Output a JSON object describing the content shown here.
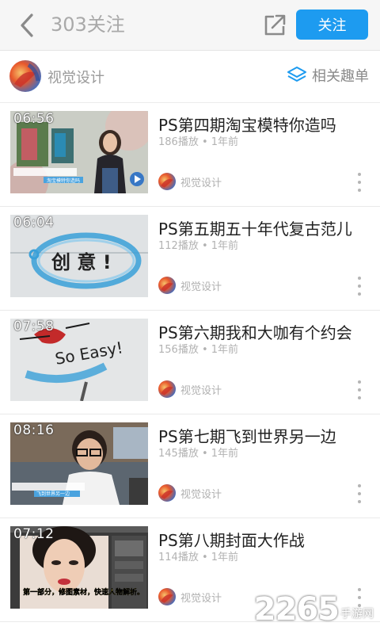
{
  "header": {
    "title": "303关注",
    "follow_label": "关注"
  },
  "channel": {
    "name": "视觉设计",
    "related_label": "相关趣单"
  },
  "videos": [
    {
      "duration": "06:56",
      "title": "PS第四期淘宝模特你造吗",
      "meta": "186播放 • 1年前",
      "author": "视觉设计"
    },
    {
      "duration": "06:04",
      "title": "PS第五期五十年代复古范儿",
      "meta": "112播放 • 1年前",
      "author": "视觉设计"
    },
    {
      "duration": "07:58",
      "title": "PS第六期我和大咖有个约会",
      "meta": "156播放 • 1年前",
      "author": "视觉设计"
    },
    {
      "duration": "08:16",
      "title": "PS第七期飞到世界另一边",
      "meta": "145播放 • 1年前",
      "author": "视觉设计"
    },
    {
      "duration": "07:12",
      "title": "PS第八期封面大作战",
      "meta": "114播放 • 1年前",
      "author": "视觉设计"
    }
  ],
  "thumb_text": {
    "v1_caption": "淘宝模特你造吗",
    "v2_word": "创 意 !",
    "v3_word": "So Easy!",
    "v4_caption": "飞到世界另一边",
    "v5_caption": "第一部分，修图素材，快速人物解析。"
  },
  "watermark": {
    "number": "2265",
    "text": "手游网"
  },
  "colors": {
    "accent": "#1d9bf0"
  }
}
